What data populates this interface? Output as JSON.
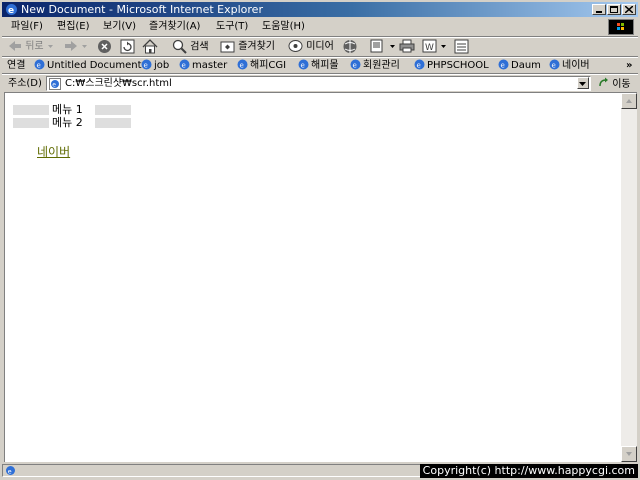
{
  "window": {
    "title": "New Document - Microsoft Internet Explorer",
    "controls": {
      "minimize": "_",
      "maximize": "□",
      "close": "×"
    }
  },
  "menubar": {
    "items": [
      "파일(F)",
      "편집(E)",
      "보기(V)",
      "즐겨찾기(A)",
      "도구(T)",
      "도움말(H)"
    ]
  },
  "toolbar": {
    "back": "뒤로",
    "search": "검색",
    "favorites": "즐겨찾기",
    "media": "미디어"
  },
  "links": {
    "label": "연결",
    "items": [
      "Untitled Document",
      "job",
      "master",
      "해피CGI",
      "해피몰",
      "회원관리",
      "PHPSCHOOL",
      "Daum",
      "네이버"
    ],
    "more": "»"
  },
  "address": {
    "label": "주소(D)",
    "value": "C:₩스크린샷₩scr.html",
    "go_label": "이동"
  },
  "content": {
    "menu_items": [
      "메뉴 1",
      "메뉴 2"
    ],
    "link_text": "네이버",
    "link_color": "#5f6b00"
  },
  "statusbar": {
    "copyright": "Copyright(c) http://www.happycgi.com"
  },
  "colors": {
    "titlebar_start": "#0a246a",
    "titlebar_end": "#a6caf0",
    "chrome": "#d4d0c8"
  }
}
